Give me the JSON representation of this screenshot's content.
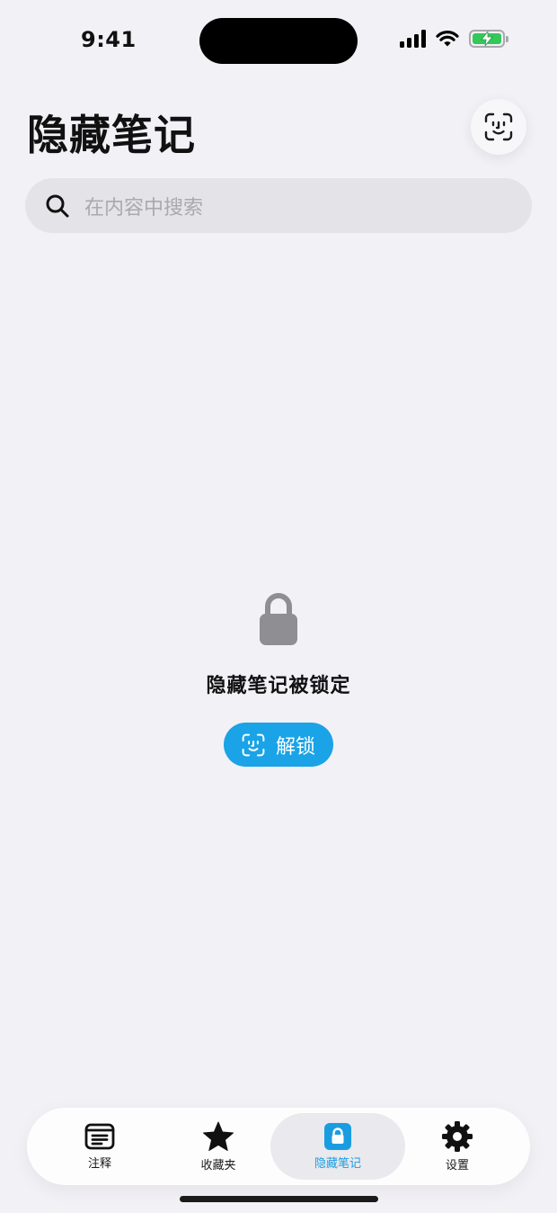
{
  "status_bar": {
    "time": "9:41"
  },
  "header": {
    "title": "隐藏笔记"
  },
  "search": {
    "placeholder": "在内容中搜索"
  },
  "locked": {
    "message": "隐藏笔记被锁定",
    "unlock_label": "解锁"
  },
  "tabs": [
    {
      "label": "注释",
      "icon": "notes-icon"
    },
    {
      "label": "收藏夹",
      "icon": "star-icon"
    },
    {
      "label": "隐藏笔记",
      "icon": "lock-icon",
      "active": true
    },
    {
      "label": "设置",
      "icon": "gear-icon"
    }
  ],
  "colors": {
    "accent": "#1aa3e6",
    "background": "#f2f1f6",
    "lock_gray": "#8e8e93",
    "battery_green": "#34c759"
  }
}
